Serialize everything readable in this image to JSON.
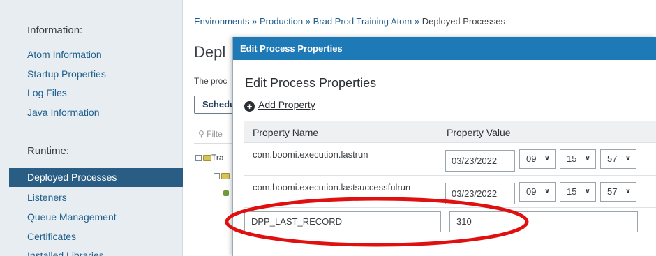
{
  "sidebar": {
    "information_title": "Information:",
    "info_items": [
      {
        "label": "Atom Information"
      },
      {
        "label": "Startup Properties"
      },
      {
        "label": "Log Files"
      },
      {
        "label": "Java Information"
      }
    ],
    "runtime_title": "Runtime:",
    "runtime_items": [
      {
        "label": "Deployed Processes",
        "active": true
      },
      {
        "label": "Listeners"
      },
      {
        "label": "Queue Management"
      },
      {
        "label": "Certificates"
      },
      {
        "label": "Installed Libraries"
      }
    ]
  },
  "main": {
    "breadcrumb": {
      "links": [
        "Environments",
        "Production",
        "Brad Prod Training Atom"
      ],
      "separator": "»",
      "current": "Deployed Processes"
    },
    "page_title": "Depl",
    "description": "The proc",
    "schedule_button": "Schedu",
    "filter_placeholder": "Filte",
    "tree": [
      {
        "label": "Tra"
      }
    ]
  },
  "dialog": {
    "header": "Edit Process Properties",
    "title": "Edit Process Properties",
    "add_property": "Add Property",
    "columns": [
      "Property Name",
      "Property Value"
    ],
    "rows": [
      {
        "name": "com.boomi.execution.lastrun",
        "date": "03/23/2022",
        "hour": "09",
        "minute": "15",
        "second": "57"
      },
      {
        "name": "com.boomi.execution.lastsuccessfulrun",
        "date": "03/23/2022",
        "hour": "09",
        "minute": "15",
        "second": "57"
      }
    ],
    "new_row": {
      "name": "DPP_LAST_RECORD",
      "value": "310"
    }
  },
  "colors": {
    "header_blue": "#1e7ab7",
    "sidebar_active": "#2a5d84",
    "link": "#1e5f8e",
    "highlight_red": "#e01010"
  }
}
